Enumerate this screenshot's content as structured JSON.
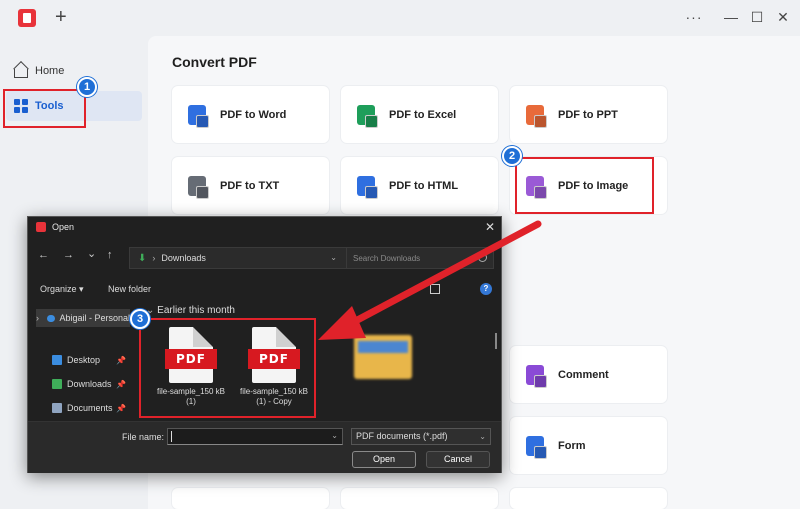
{
  "window": {
    "new_tab": "+",
    "more": "···",
    "minimize": "—",
    "maximize": "☐",
    "close": "✕"
  },
  "sidebar": {
    "items": [
      {
        "label": "Home",
        "icon": "home-icon"
      },
      {
        "label": "Tools",
        "icon": "tools-icon",
        "selected": true
      }
    ]
  },
  "main": {
    "section_title": "Convert PDF",
    "tools": [
      {
        "label": "PDF to Word",
        "color": "#2f6fe0",
        "icon": "word-icon"
      },
      {
        "label": "PDF to Excel",
        "color": "#1e9e5a",
        "icon": "excel-icon"
      },
      {
        "label": "PDF to PPT",
        "color": "#e86a3a",
        "icon": "ppt-icon"
      },
      {
        "label": "PDF to TXT",
        "color": "#666c75",
        "icon": "txt-icon"
      },
      {
        "label": "PDF to HTML",
        "color": "#2f6fe0",
        "icon": "html-icon"
      },
      {
        "label": "PDF to Image",
        "color": "#9a5ad6",
        "icon": "image-icon"
      },
      {
        "label": "Comment",
        "color": "#8a4ad6",
        "icon": "comment-icon"
      },
      {
        "label": "Form",
        "color": "#2f6fe0",
        "icon": "form-icon"
      }
    ]
  },
  "annotations": {
    "step1": "1",
    "step2": "2",
    "step3": "3"
  },
  "dialog": {
    "title": "Open",
    "close": "✕",
    "nav": {
      "back": "←",
      "forward": "→",
      "recent": "⌄",
      "up": "↑"
    },
    "address": "Downloads",
    "search_placeholder": "Search Downloads",
    "commands": {
      "organize": "Organize ▾",
      "new_folder": "New folder",
      "help": "?"
    },
    "tree": {
      "onedrive": "Abigail - Personal",
      "quick_access": [
        {
          "label": "Desktop",
          "color": "#3b8de0"
        },
        {
          "label": "Downloads",
          "color": "#3fae5a"
        },
        {
          "label": "Documents",
          "color": "#8fa4c0"
        }
      ]
    },
    "group_header": "Earlier this month",
    "files": [
      {
        "name": "file-sample_150 kB (1)",
        "badge": "PDF"
      },
      {
        "name": "file-sample_150 kB (1) - Copy",
        "badge": "PDF"
      }
    ],
    "file_name_label": "File name:",
    "file_name_value": "",
    "file_type": "PDF documents (*.pdf)",
    "open_button": "Open",
    "cancel_button": "Cancel"
  }
}
